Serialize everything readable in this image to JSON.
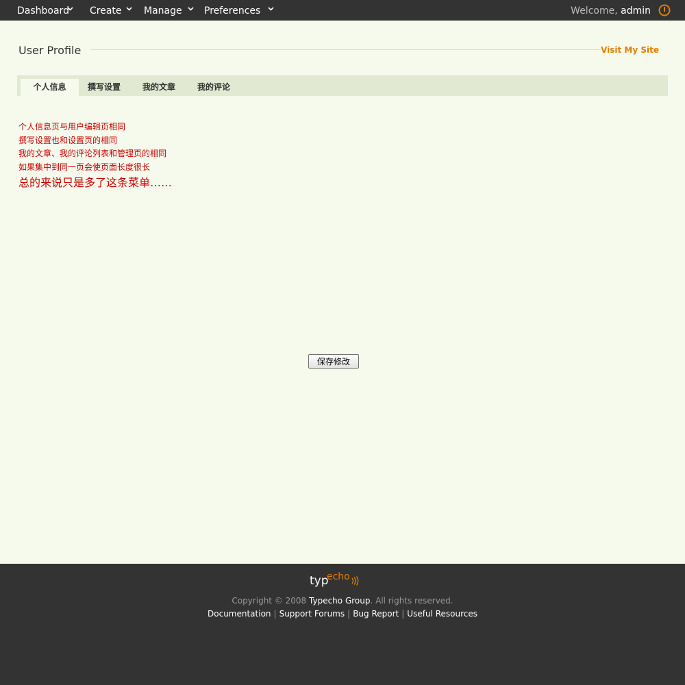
{
  "nav": {
    "items": [
      {
        "label": "Dashboard"
      },
      {
        "label": "Create"
      },
      {
        "label": "Manage"
      },
      {
        "label": "Preferences"
      }
    ],
    "welcome_prefix": "Welcome,",
    "user": "admin"
  },
  "header": {
    "title": "User Profile",
    "visit_link": "Visit My Site"
  },
  "tabs": [
    {
      "label": "个人信息",
      "active": true
    },
    {
      "label": "撰写设置",
      "active": false
    },
    {
      "label": "我的文章",
      "active": false
    },
    {
      "label": "我的评论",
      "active": false
    }
  ],
  "notes": {
    "lines": [
      "个人信息页与用户编辑页相同",
      "撰写设置也和设置页的相同",
      "我的文章、我的评论列表和管理页的相同",
      "如果集中到同一页会使页面长度很长"
    ],
    "summary": "总的来说只是多了这条菜单……"
  },
  "form": {
    "save_label": "保存修改"
  },
  "footer": {
    "logo_typ": "typ",
    "logo_echo": "echo",
    "copyright_prefix": "Copyright © 2008",
    "copyright_brand": "Typecho Group",
    "copyright_suffix": ". All rights reserved.",
    "links": [
      "Documentation",
      "Support Forums",
      "Bug Report",
      "Useful Resources"
    ],
    "separator": "|"
  },
  "colors": {
    "topbar": "#333333",
    "background": "#f5faed",
    "accent": "#e47e00",
    "note_text": "#cc0000",
    "tabbar": "#e1e9d2"
  },
  "icons": {
    "dropdown": "chevron-down-icon",
    "logout": "power-icon"
  }
}
